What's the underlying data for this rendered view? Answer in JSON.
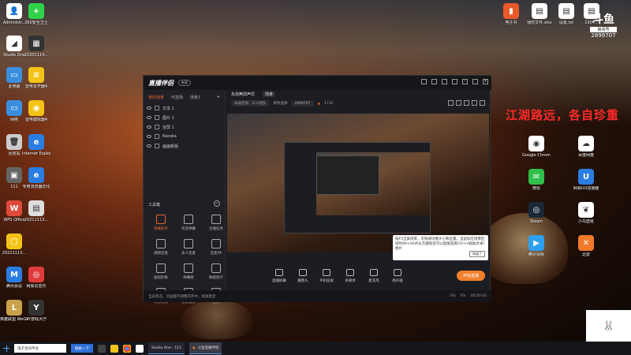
{
  "desktop": {
    "left_icons": [
      {
        "label": "Administr...",
        "color": "#ffffff",
        "glyph": "👤"
      },
      {
        "label": "360安全卫士",
        "color": "#2fd34a",
        "glyph": "+"
      },
      {
        "label": "Studio One",
        "color": "#ffffff",
        "glyph": "◢"
      },
      {
        "label": "20201114...",
        "color": "#333333",
        "glyph": "▦"
      },
      {
        "label": "此电脑",
        "color": "#3a8ee0",
        "glyph": "▭"
      },
      {
        "label": "雷电多开器4",
        "color": "#f3c417",
        "glyph": "≡"
      },
      {
        "label": "网络",
        "color": "#3a8ee0",
        "glyph": "▭"
      },
      {
        "label": "雷电模拟器4",
        "color": "#f3c417",
        "glyph": "◉"
      },
      {
        "label": "回收站",
        "color": "#cccccc",
        "glyph": "🗑"
      },
      {
        "label": "Internet Explorer",
        "color": "#2a7de1",
        "glyph": "e"
      },
      {
        "label": "111",
        "color": "#666666",
        "glyph": "▣"
      },
      {
        "label": "专用浏览器优化",
        "color": "#2a7de1",
        "glyph": "e"
      },
      {
        "label": "WPS Office",
        "color": "#e04a3a",
        "glyph": "W"
      },
      {
        "label": "20211113...",
        "color": "#dddddd",
        "glyph": "▤"
      },
      {
        "label": "20211113...",
        "color": "#f3c417",
        "glyph": "▢"
      },
      {
        "label": "腾讯会议",
        "color": "#2a7de1",
        "glyph": "M"
      },
      {
        "label": "网易云音乐",
        "color": "#e03a3a",
        "glyph": "◎"
      },
      {
        "label": "英雄联盟 WeGame版",
        "color": "#c9a24a",
        "glyph": "L"
      },
      {
        "label": "YY游戏大厅",
        "color": "#333333",
        "glyph": "Y"
      }
    ],
    "top_icons": [
      {
        "label": "电子书",
        "color": "#e85a2a",
        "glyph": "▮"
      },
      {
        "label": "我的文件.xlsx",
        "color": "#ffffff",
        "glyph": "▤"
      },
      {
        "label": "设置.txt",
        "color": "#ffffff",
        "glyph": "▤"
      },
      {
        "label": "1904...",
        "color": "#ffffff",
        "glyph": "▤"
      }
    ],
    "right_icons": [
      {
        "label": "Google Chrome",
        "color": "#ffffff",
        "glyph": "◉"
      },
      {
        "label": "百度网盘",
        "color": "#ffffff",
        "glyph": "☁"
      },
      {
        "label": "微信",
        "color": "#2fbf4a",
        "glyph": "✉"
      },
      {
        "label": "网易UU加速器",
        "color": "#2a7de1",
        "glyph": "U"
      },
      {
        "label": "Steam",
        "color": "#1b2838",
        "glyph": "◎"
      },
      {
        "label": "小鸟壁纸",
        "color": "#ffffff",
        "glyph": "❦"
      },
      {
        "label": "腾讯视频",
        "color": "#2fa0f0",
        "glyph": "▶"
      },
      {
        "label": "迅雷",
        "color": "#f07a2a",
        "glyph": "✕"
      }
    ],
    "overlay_text": "江湖路远，各自珍重",
    "room_logo": "斗鱼",
    "room_label": "房间号",
    "room_number": "2899707"
  },
  "app": {
    "logo": "直播伴侣",
    "badge": "新版",
    "left_tabs": [
      "我的场景",
      "可选场",
      "场景1"
    ],
    "sources": [
      "文本 1",
      "图片 1",
      "全屏 1",
      "Naraka",
      "画画新版"
    ],
    "tools_title": "工具箱",
    "tools": [
      "弹幕助手",
      "欢迎弹幕",
      "主播任务",
      "视频连麦",
      "多人连麦",
      "连麦PK",
      "虚拟形象",
      "弹幕姬",
      "数据统计",
      "礼物特效",
      "语音播报",
      "更多"
    ],
    "main_tabs": [
      "永劫無間声优",
      "场景"
    ],
    "info": {
      "category": "永劫无间 - 三人组队",
      "modify": "修改选择",
      "viewers": "2899707",
      "hot": "1732"
    },
    "bottom_buttons": [
      "直播屏幕",
      "摄像头",
      "手机投屏",
      "多媒体",
      "麦克风",
      "扬声器"
    ],
    "start_button": "开始直播",
    "status_text": "当前状态，对画面不调整内存中，帧速稳定",
    "status_right": [
      "0%",
      "0%",
      "00:00:00"
    ]
  },
  "tooltip": {
    "text": "按F5全屏场景，可快速切换大小和位置，当鼠标在场景区域时Alt+Shift与方键组合可以直接选择Ctrl+V粘贴文本/图片",
    "button": "知道了"
  },
  "taskbar": {
    "search_text": "电子合同平台",
    "search_button": "搜索一下",
    "tasks": [
      "Studio One - 111",
      "斗鱼直播伴侣"
    ]
  }
}
